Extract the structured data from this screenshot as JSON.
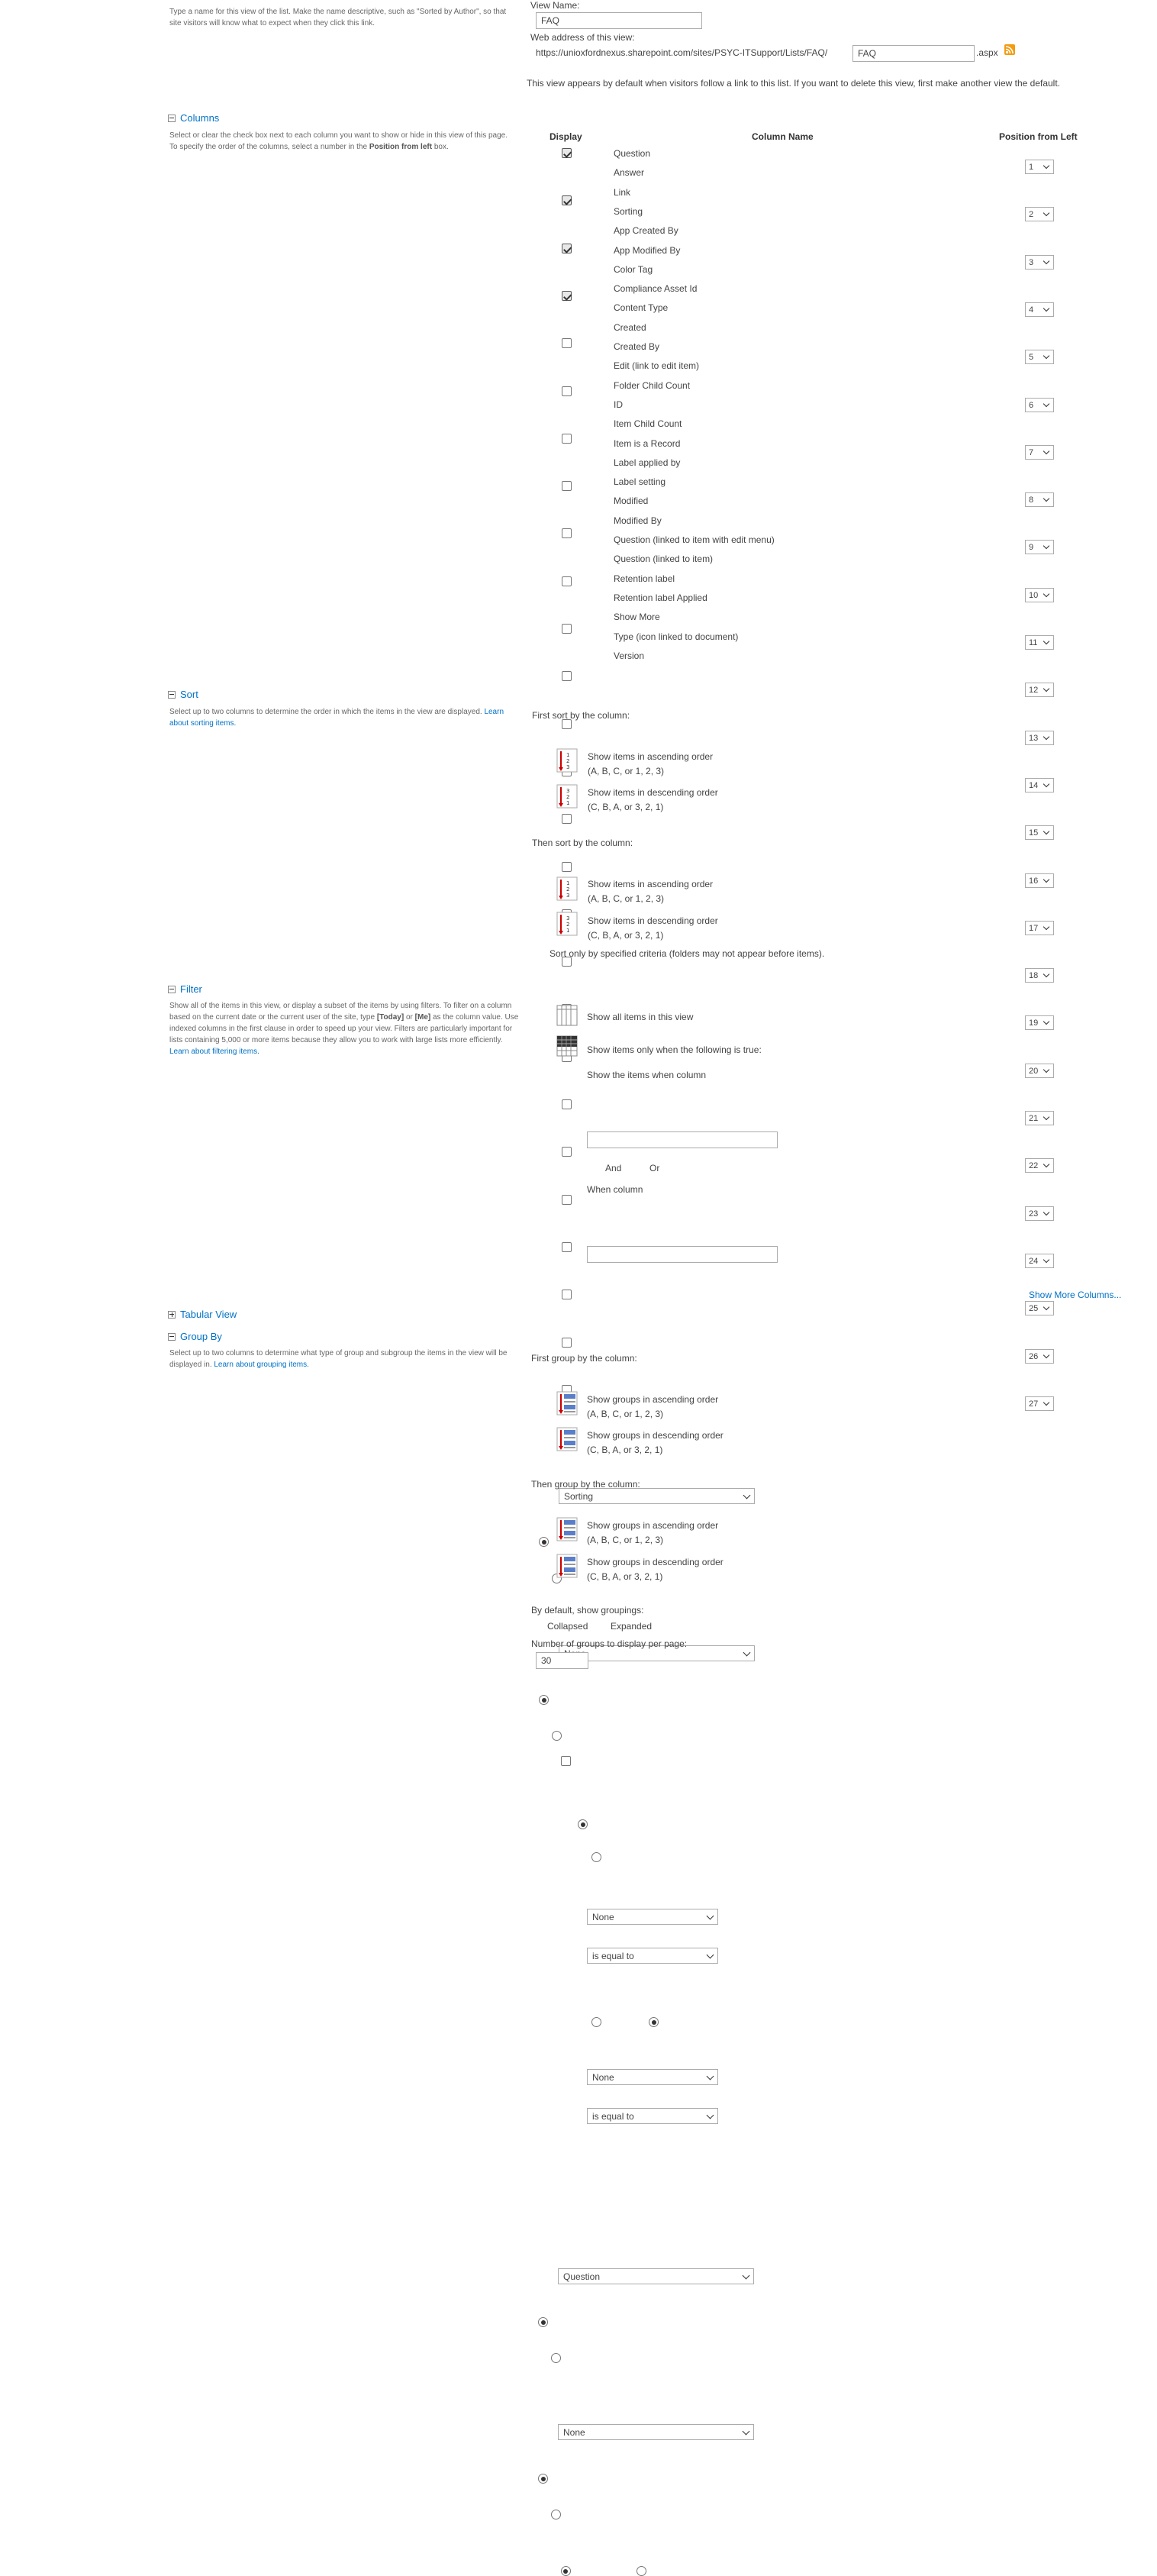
{
  "name_section": {
    "description": "Type a name for this view of the list. Make the name descriptive, such as \"Sorted by Author\", so that site visitors will know what to expect when they click this link.",
    "view_name_label": "View Name:",
    "view_name_value": "FAQ",
    "web_address_label": "Web address of this view:",
    "url_prefix": "https://unioxfordnexus.sharepoint.com/sites/PSYC-ITSupport/Lists/FAQ/",
    "url_value": "FAQ",
    "url_suffix": ".aspx",
    "default_note": "This view appears by default when visitors follow a link to this list. If you want to delete this view, first make another view the default."
  },
  "columns_section": {
    "title": "Columns",
    "description_1": "Select or clear the check box next to each column you want to show or hide in this view of this page. To specify the order of the columns, select a number in the ",
    "description_bold": "Position from left",
    "description_2": " box.",
    "header_display": "Display",
    "header_column_name": "Column Name",
    "header_position": "Position from Left",
    "rows": [
      {
        "name": "Question",
        "checked": true,
        "pos": "1"
      },
      {
        "name": "Answer",
        "checked": true,
        "pos": "2"
      },
      {
        "name": "Link",
        "checked": true,
        "pos": "3"
      },
      {
        "name": "Sorting",
        "checked": true,
        "pos": "4"
      },
      {
        "name": "App Created By",
        "checked": false,
        "pos": "5"
      },
      {
        "name": "App Modified By",
        "checked": false,
        "pos": "6"
      },
      {
        "name": "Color Tag",
        "checked": false,
        "pos": "7"
      },
      {
        "name": "Compliance Asset Id",
        "checked": false,
        "pos": "8"
      },
      {
        "name": "Content Type",
        "checked": false,
        "pos": "9"
      },
      {
        "name": "Created",
        "checked": false,
        "pos": "10"
      },
      {
        "name": "Created By",
        "checked": false,
        "pos": "11"
      },
      {
        "name": "Edit (link to edit item)",
        "checked": false,
        "pos": "12"
      },
      {
        "name": "Folder Child Count",
        "checked": false,
        "pos": "13"
      },
      {
        "name": "ID",
        "checked": false,
        "pos": "14"
      },
      {
        "name": "Item Child Count",
        "checked": false,
        "pos": "15"
      },
      {
        "name": "Item is a Record",
        "checked": false,
        "pos": "16"
      },
      {
        "name": "Label applied by",
        "checked": false,
        "pos": "17"
      },
      {
        "name": "Label setting",
        "checked": false,
        "pos": "18"
      },
      {
        "name": "Modified",
        "checked": false,
        "pos": "19"
      },
      {
        "name": "Modified By",
        "checked": false,
        "pos": "20"
      },
      {
        "name": "Question (linked to item with edit menu)",
        "checked": false,
        "pos": "21"
      },
      {
        "name": "Question (linked to item)",
        "checked": false,
        "pos": "22"
      },
      {
        "name": "Retention label",
        "checked": false,
        "pos": "23"
      },
      {
        "name": "Retention label Applied",
        "checked": false,
        "pos": "24"
      },
      {
        "name": "Show More",
        "checked": false,
        "pos": "25"
      },
      {
        "name": "Type (icon linked to document)",
        "checked": false,
        "pos": "26"
      },
      {
        "name": "Version",
        "checked": false,
        "pos": "27"
      }
    ]
  },
  "sort_section": {
    "title": "Sort",
    "description": "Select up to two columns to determine the order in which the items in the view are displayed. ",
    "learn_link": "Learn about sorting items.",
    "first_label": "First sort by the column:",
    "first_value": "Sorting",
    "asc_line1": "Show items in ascending order",
    "asc_line2": "(A, B, C, or 1, 2, 3)",
    "desc_line1": "Show items in descending order",
    "desc_line2": "(C, B, A, or 3, 2, 1)",
    "then_label": "Then sort by the column:",
    "then_value": "None",
    "only_specified": "Sort only by specified criteria (folders may not appear before items)."
  },
  "filter_section": {
    "title": "Filter",
    "desc_1": "Show all of the items in this view, or display a subset of the items by using filters. To filter on a column based on the current date or the current user of the site, type ",
    "desc_today": "[Today]",
    "desc_2": " or ",
    "desc_me": "[Me]",
    "desc_3": " as the column value. Use indexed columns in the first clause in order to speed up your view. Filters are particularly important for lists containing 5,000 or more items because they allow you to work with large lists more efficiently. ",
    "learn_link": "Learn about filtering items.",
    "show_all": "Show all items in this view",
    "show_when": "Show items only when the following is true:",
    "show_items_when_column": "Show the items when column",
    "col1_value": "None",
    "op1_value": "is equal to",
    "and_label": "And",
    "or_label": "Or",
    "when_column": "When column",
    "col2_value": "None",
    "op2_value": "is equal to",
    "show_more_columns": "Show More Columns..."
  },
  "tabular_section": {
    "title": "Tabular View"
  },
  "group_section": {
    "title": "Group By",
    "description": "Select up to two columns to determine what type of group and subgroup the items in the view will be displayed in. ",
    "learn_link": "Learn about grouping items.",
    "first_label": "First group by the column:",
    "first_value": "Question",
    "asc_line1": "Show groups in ascending order",
    "asc_line2": "(A, B, C, or 1, 2, 3)",
    "desc_line1": "Show groups in descending order",
    "desc_line2": "(C, B, A, or 3, 2, 1)",
    "then_label": "Then group by the column:",
    "then_value": "None",
    "default_label": "By default, show groupings:",
    "collapsed": "Collapsed",
    "expanded": "Expanded",
    "num_groups_label": "Number of groups to display per page:",
    "num_groups_value": "30"
  }
}
